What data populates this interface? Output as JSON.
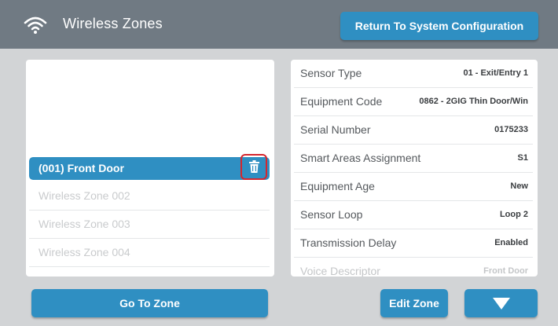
{
  "header": {
    "title": "Wireless Zones",
    "title_icon": "wifi-icon",
    "return_button_label": "Return To System Configuration"
  },
  "zones": {
    "items": [
      {
        "label": "(001) Front Door",
        "selected": true,
        "action_icon": "trash-icon"
      },
      {
        "label": "Wireless Zone 002",
        "selected": false
      },
      {
        "label": "Wireless Zone 003",
        "selected": false
      },
      {
        "label": "Wireless Zone 004",
        "selected": false
      }
    ]
  },
  "properties": [
    {
      "label": "Sensor Type",
      "value": "01 - Exit/Entry 1"
    },
    {
      "label": "Equipment Code",
      "value": "0862 - 2GIG Thin Door/Win"
    },
    {
      "label": "Serial Number",
      "value": "0175233"
    },
    {
      "label": "Smart Areas Assignment",
      "value": "S1"
    },
    {
      "label": "Equipment Age",
      "value": "New"
    },
    {
      "label": "Sensor Loop",
      "value": "Loop 2"
    },
    {
      "label": "Transmission Delay",
      "value": "Enabled"
    },
    {
      "label": "Voice Descriptor",
      "value": "Front Door"
    }
  ],
  "footer": {
    "go_to_zone_label": "Go To Zone",
    "edit_zone_label": "Edit Zone",
    "scroll_down_icon": "triangle-down-icon"
  },
  "colors": {
    "accent": "#2f8fc2",
    "titlebar": "#707a83",
    "background": "#d2d4d6",
    "highlight": "#d4262e"
  }
}
